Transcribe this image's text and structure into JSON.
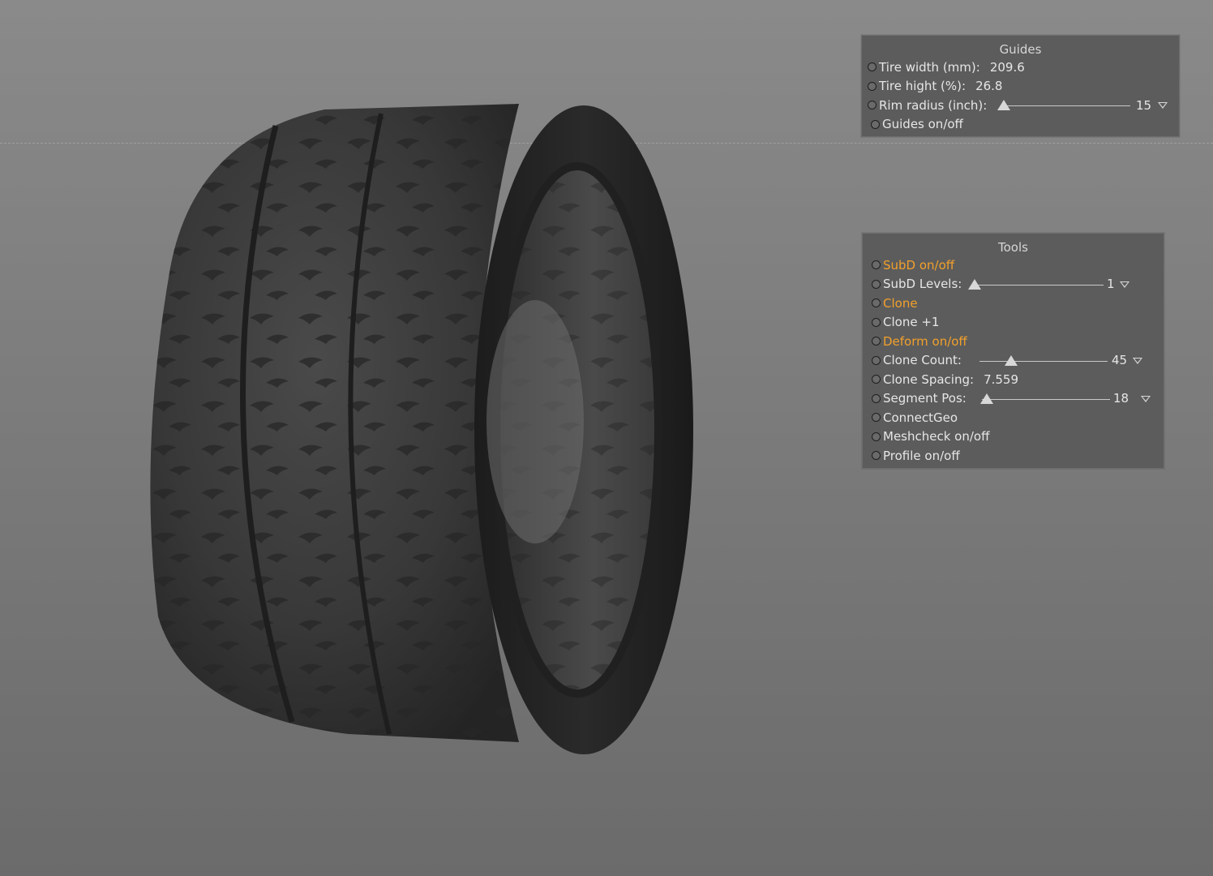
{
  "guides_panel": {
    "title": "Guides",
    "rows": {
      "tire_width": {
        "label": "Tire width (mm):",
        "value": "209.6"
      },
      "tire_height": {
        "label": "Tire hight (%):",
        "value": "26.8"
      },
      "rim_radius": {
        "label": "Rim radius (inch):",
        "value": "15",
        "slider_fraction": 0.0
      },
      "guides_toggle": {
        "label": "Guides on/off"
      }
    }
  },
  "tools_panel": {
    "title": "Tools",
    "rows": {
      "subd_toggle": {
        "label": "SubD on/off",
        "highlighted": true
      },
      "subd_levels": {
        "label": "SubD Levels:",
        "value": "1",
        "slider_fraction": 0.0
      },
      "clone": {
        "label": "Clone",
        "highlighted": true
      },
      "clone_plus": {
        "label": "Clone +1"
      },
      "deform_toggle": {
        "label": "Deform on/off",
        "highlighted": true
      },
      "clone_count": {
        "label": "Clone Count:",
        "value": "45",
        "slider_fraction": 0.25
      },
      "clone_spacing": {
        "label": "Clone Spacing:",
        "value": "7.559"
      },
      "segment_pos": {
        "label": "Segment Pos:",
        "value": "18",
        "slider_fraction": 0.0
      },
      "connect_geo": {
        "label": "ConnectGeo"
      },
      "meshcheck_toggle": {
        "label": "Meshcheck on/off"
      },
      "profile_toggle": {
        "label": "Profile on/off"
      }
    }
  },
  "colors": {
    "background": "#808080",
    "panel": "#5c5c5c",
    "accent": "#f2a02b",
    "text": "#e6e6e6",
    "tire": "#2b2b2b"
  },
  "icons": {
    "radio": "radio-button-icon",
    "dropdown": "triangle-down-icon",
    "slider_thumb": "triangle-up-icon"
  }
}
